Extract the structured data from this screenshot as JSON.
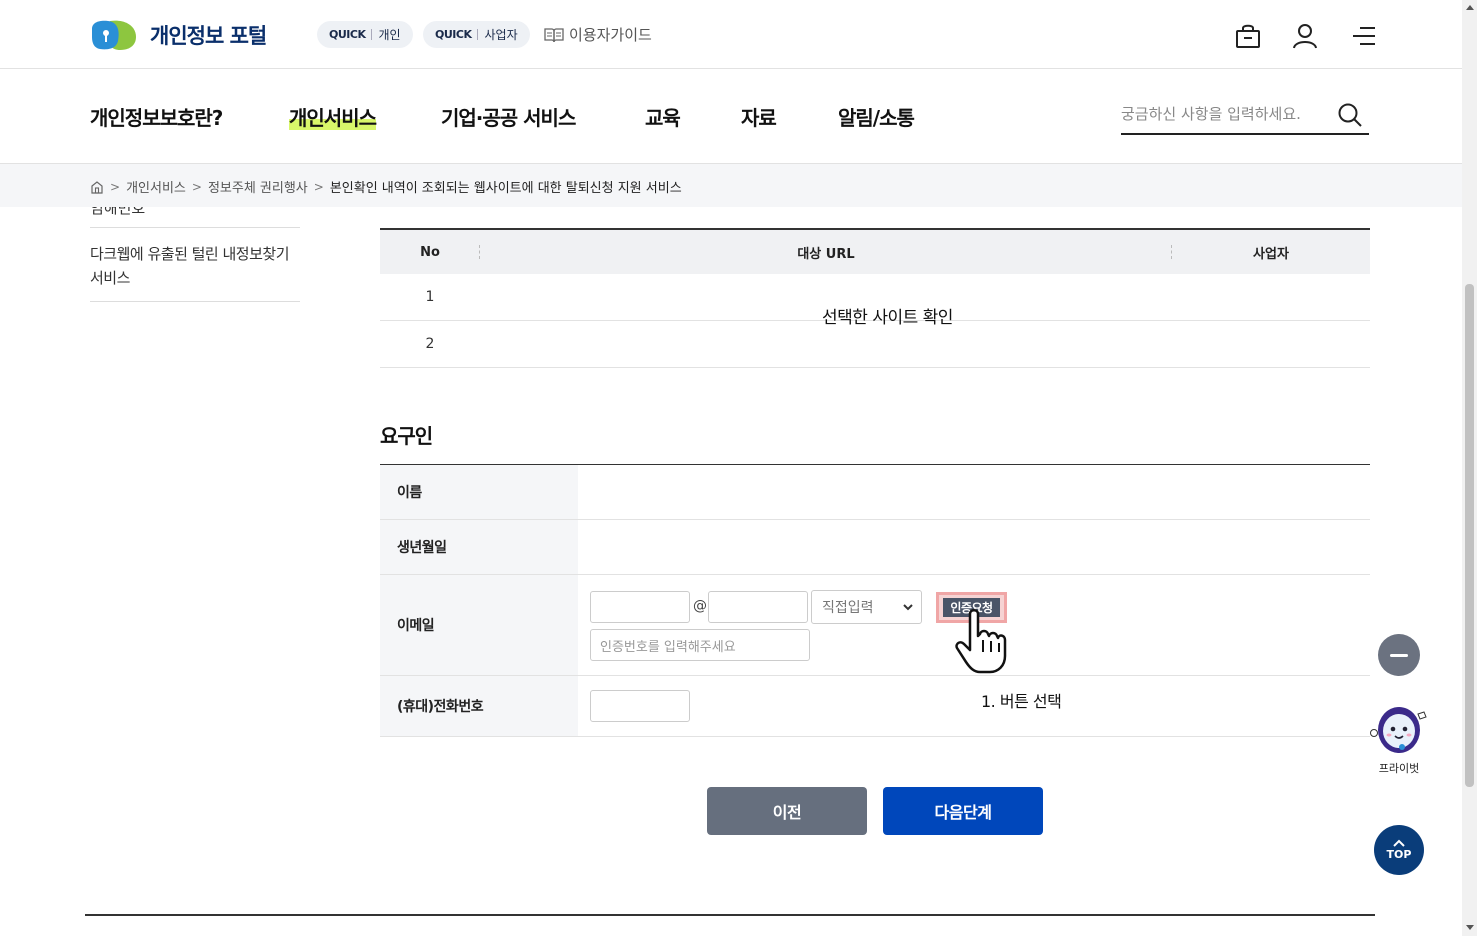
{
  "header": {
    "logo_text": "개인정보 포털",
    "quick_personal": {
      "tag": "QUICK",
      "label": "개인"
    },
    "quick_business": {
      "tag": "QUICK",
      "label": "사업자"
    },
    "guide_label": "이용자가이드"
  },
  "nav": {
    "items": [
      "개인정보보호란?",
      "개인서비스",
      "기업·공공 서비스",
      "교육",
      "자료",
      "알림/소통"
    ],
    "active_index": 1,
    "search_placeholder": "궁금하신 사항을 입력하세요."
  },
  "breadcrumb": {
    "items": [
      "개인서비스",
      "정보주체 권리행사"
    ],
    "current": "본인확인 내역이 조회되는 웹사이트에 대한 탈퇴신청 지원 서비스"
  },
  "sidebar": {
    "cut_item": "임해번호",
    "item": "다크웹에 유출된 털린 내정보찾기 서비스"
  },
  "site_table": {
    "headers": [
      "No",
      "대상 URL",
      "사업자"
    ],
    "rows": [
      {
        "no": "1"
      },
      {
        "no": "2"
      }
    ],
    "overlay": "선택한 사이트 확인"
  },
  "requester": {
    "title": "요구인",
    "fields": {
      "name_label": "이름",
      "birth_label": "생년월일",
      "email_label": "이메일",
      "phone_label": "(휴대)전화번호"
    },
    "email_at": "@",
    "domain_select": "직접입력",
    "cert_button": "인증요청",
    "code_placeholder": "인증번호를 입력해주세요"
  },
  "annotation": "1. 버튼 선택",
  "buttons": {
    "prev": "이전",
    "next": "다음단계"
  },
  "floating": {
    "bot_label": "프라이벗",
    "top_label": "TOP"
  },
  "colors": {
    "primary": "#0047bb",
    "secondary": "#666f7e",
    "nav_highlight": "#d8f76a"
  }
}
